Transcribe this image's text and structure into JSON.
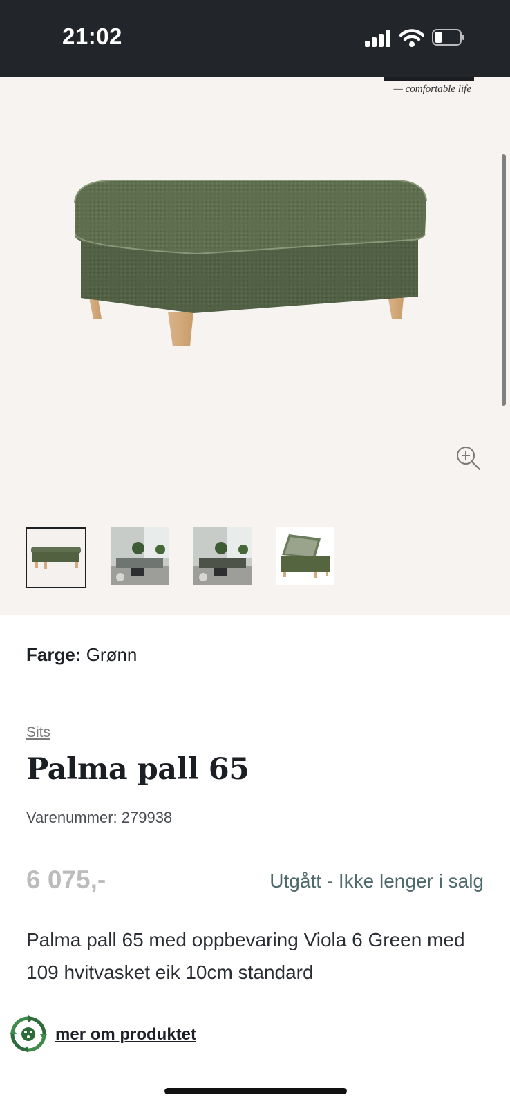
{
  "status_bar": {
    "time": "21:02"
  },
  "brand": {
    "tagline": "— comfortable life"
  },
  "gallery": {
    "thumbnails": [
      {
        "name": "ottoman-front",
        "selected": true
      },
      {
        "name": "living-room-1",
        "selected": false
      },
      {
        "name": "living-room-2",
        "selected": false
      },
      {
        "name": "ottoman-open-storage",
        "selected": false
      }
    ]
  },
  "product": {
    "color_label": "Farge:",
    "color_value": "Grønn",
    "category": "Sits",
    "title": "Palma pall 65",
    "sku": "Varenummer: 279938",
    "price": "6 075,-",
    "availability": "Utgått - Ikke lenger i salg",
    "description": "Palma pall 65 med oppbevaring Viola 6 Green med 109 hvitvasket eik 10cm standard",
    "more_link": "mer om produktet"
  },
  "colors": {
    "status_bar_bg": "#22252a",
    "gallery_bg": "#f6f3f1",
    "fabric_green": "#5b6b4c",
    "availability_text": "#4e6a6c",
    "price_text": "#bcbcbc"
  }
}
